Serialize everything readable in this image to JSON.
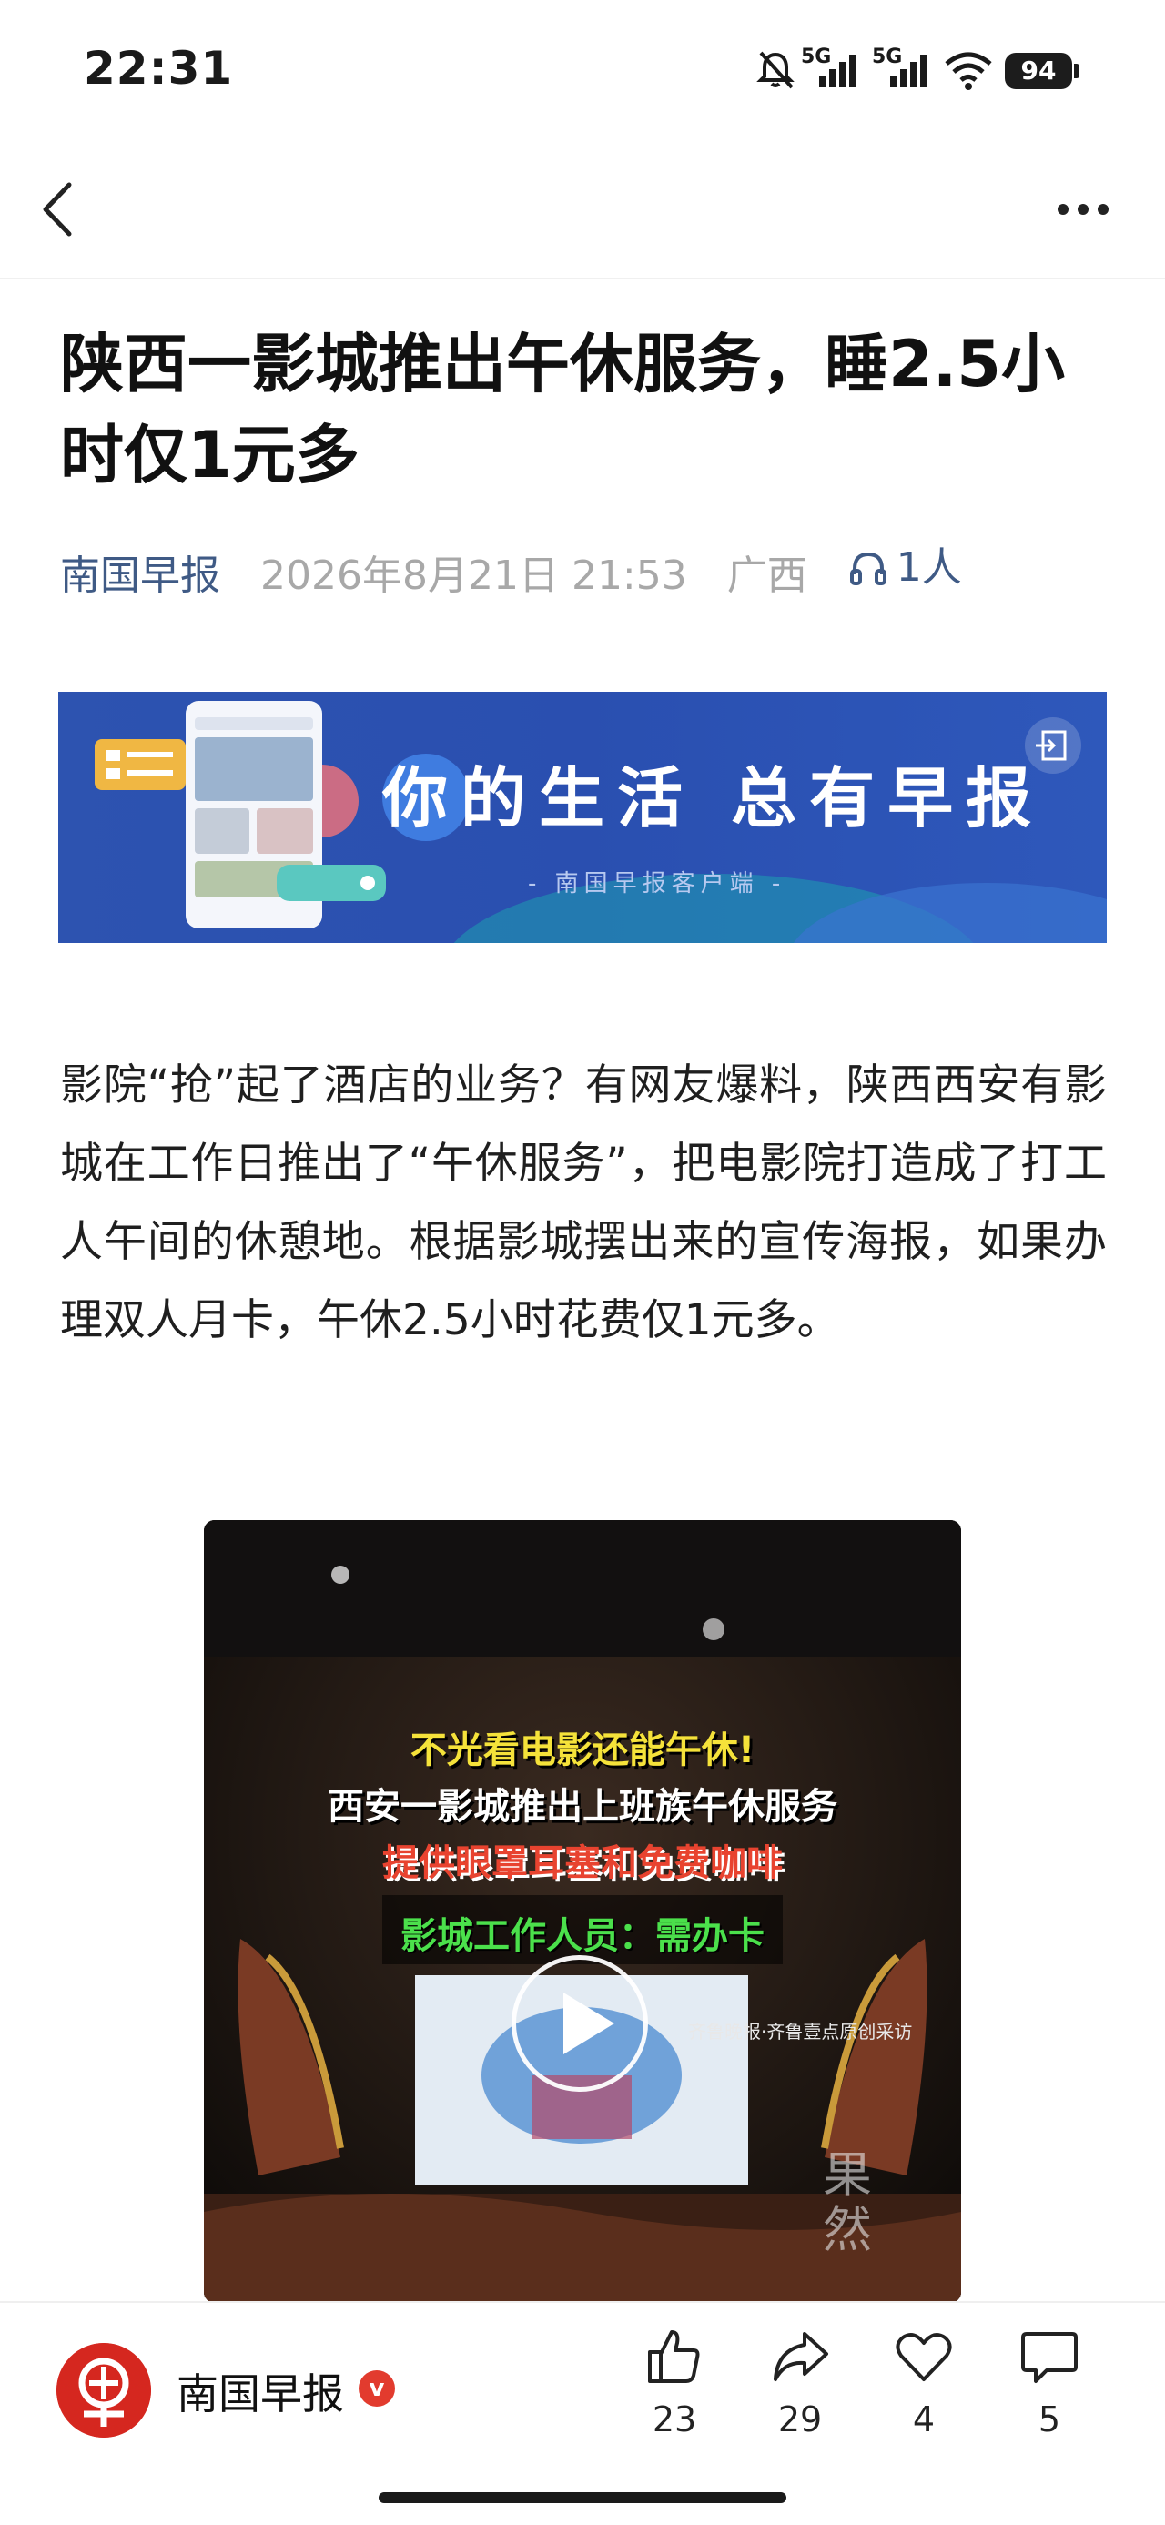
{
  "status_bar": {
    "time": "22:31",
    "battery": "94",
    "signal_1": "5G",
    "signal_2": "5G",
    "icons": [
      "mute-icon",
      "signal-5g-icon",
      "signal-5g-icon",
      "wifi-icon",
      "battery-icon"
    ]
  },
  "nav": {
    "back_icon": "chevron-left-icon",
    "more_icon": "more-dots-icon"
  },
  "article": {
    "title": "陕西一影城推出午休服务，睡2.5小时仅1元多",
    "source": "南国早报",
    "date": "2026年8月21日 21:53",
    "region": "广西",
    "listeners": "1人",
    "body": "影院“抢”起了酒店的业务？有网友爆料，陕西西安有影城在工作日推出了“午休服务”，把电影院打造成了打工人午间的休憩地。根据影城摆出来的宣传海报，如果办理双人月卡，午休2.5小时花费仅1元多。"
  },
  "banner": {
    "slogan": "你的生活 总有早报",
    "subtitle": "- 南国早报客户端 -"
  },
  "video": {
    "caption_1": "不光看电影还能午休!",
    "caption_2": "西安一影城推出上班族午休服务",
    "caption_3": "提供眼罩耳塞和免费咖啡",
    "caption_4": "影城工作人员：需办卡",
    "credit": "齐鲁晚报·齐鲁壹点原创采访",
    "watermark": "果然"
  },
  "bottom_bar": {
    "publisher": "南国早报",
    "verified_badge": "v",
    "like_count": "23",
    "share_count": "29",
    "favorite_count": "4",
    "comment_count": "5"
  },
  "colors": {
    "accent_blue": "#3f5a85",
    "banner_blue": "#2d53b0",
    "brand_red": "#d5271f",
    "caption_yellow": "#f5e23a",
    "caption_red": "#e8432f",
    "caption_green": "#4be04b"
  }
}
